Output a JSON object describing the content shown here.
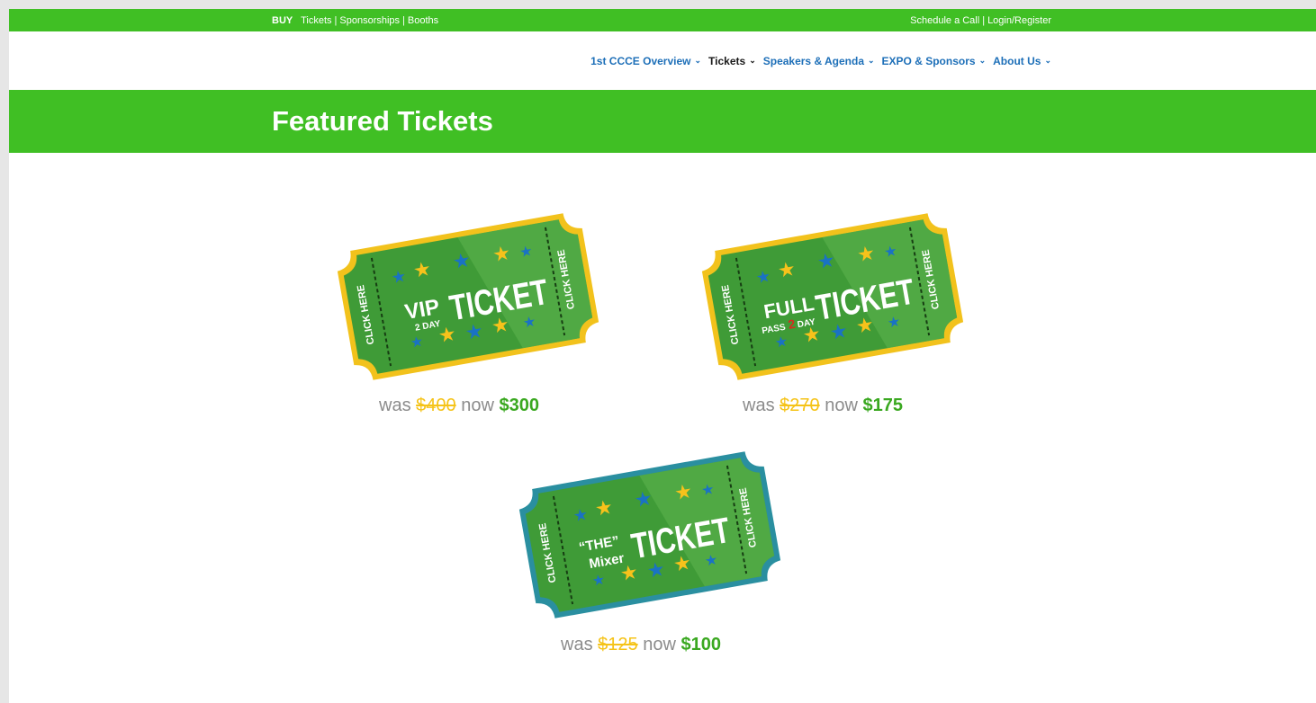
{
  "utility_bar": {
    "buy_label": "BUY",
    "links": [
      "Tickets",
      "Sponsorships",
      "Booths"
    ],
    "right_links": [
      "Schedule a Call",
      "Login/Register"
    ],
    "separator": "|"
  },
  "nav": {
    "items": [
      {
        "label": "1st CCCE Overview"
      },
      {
        "label": "Tickets"
      },
      {
        "label": "Speakers & Agenda"
      },
      {
        "label": "EXPO & Sponsors"
      },
      {
        "label": "About Us"
      }
    ],
    "chevron": "⌄"
  },
  "banner": {
    "title": "Featured Tickets"
  },
  "tickets": [
    {
      "click_label": "CLICK HERE",
      "line1": "VIP",
      "line2": "2 DAY",
      "main": "TICKET",
      "price": {
        "was_label": "was",
        "was": "$400",
        "now_label": "now",
        "now": "$300"
      }
    },
    {
      "click_label": "CLICK HERE",
      "line1": "FULL",
      "line2a": "PASS",
      "line2b": "2",
      "line2c": "DAY",
      "main": "TICKET",
      "price": {
        "was_label": "was",
        "was": "$270",
        "now_label": "now",
        "now": "$175"
      }
    },
    {
      "click_label": "CLICK HERE",
      "line1": "“THE”",
      "line2": "Mixer",
      "main": "TICKET",
      "price": {
        "was_label": "was",
        "was": "$125",
        "now_label": "now",
        "now": "$100"
      }
    }
  ],
  "colors": {
    "brand_green": "#40bf24",
    "nav_blue": "#1d6fb8",
    "was_yellow": "#f5c318",
    "now_green": "#3aa820",
    "ticket_green": "#3f9b37",
    "ticket_border_gold": "#f2c21c",
    "ticket_border_teal": "#2a8fa0",
    "star_yellow": "#f7c21b",
    "star_blue": "#1a72c4"
  }
}
